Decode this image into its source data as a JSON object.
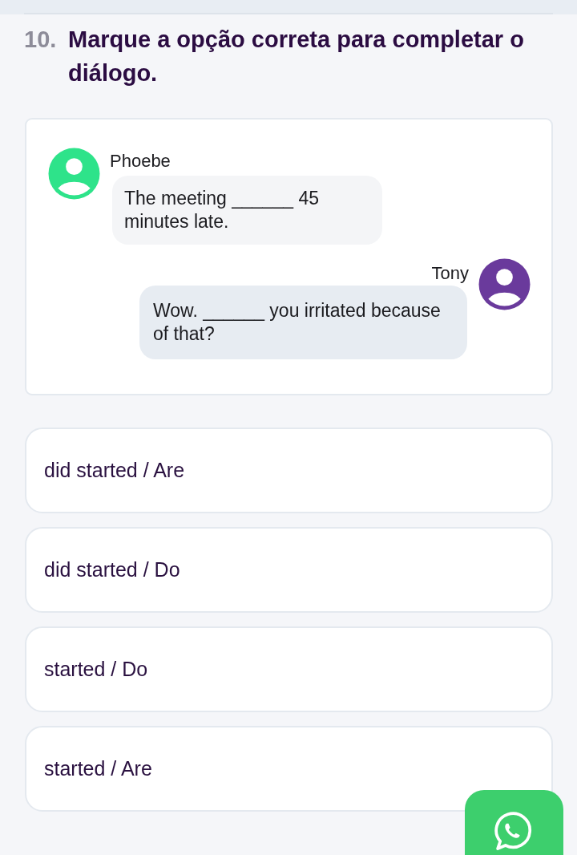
{
  "question": {
    "number": "10.",
    "text": "Marque a opção correta para completar o diálogo."
  },
  "dialog": {
    "messages": [
      {
        "kind": "received",
        "sender": "Phoebe",
        "color": "#2ee38a",
        "text": "The meeting ______ 45 minutes late."
      },
      {
        "kind": "sent",
        "sender": "Tony",
        "color": "#6a3a9c",
        "text": "Wow. ______ you irritated because of that?"
      }
    ]
  },
  "options": [
    {
      "text": "did started / Are",
      "selected": false
    },
    {
      "text": "did started / Do",
      "selected": false
    },
    {
      "text": "started / Do",
      "selected": false
    },
    {
      "text": "started / Are",
      "selected": false
    }
  ]
}
